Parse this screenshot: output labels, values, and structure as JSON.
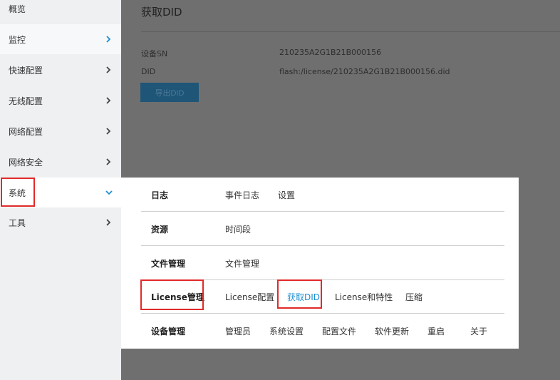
{
  "sidebar": {
    "items": [
      {
        "label": "概览",
        "chevron": false
      },
      {
        "label": "监控",
        "chevron": true
      },
      {
        "label": "快速配置",
        "chevron": true
      },
      {
        "label": "无线配置",
        "chevron": true
      },
      {
        "label": "网络配置",
        "chevron": true
      },
      {
        "label": "网络安全",
        "chevron": true
      },
      {
        "label": "系统",
        "chevron": true,
        "expanded": true
      },
      {
        "label": "工具",
        "chevron": true
      }
    ]
  },
  "content": {
    "title": "获取DID",
    "fields": [
      {
        "label": "设备SN",
        "value": "210235A2G1B21B000156"
      },
      {
        "label": "DID",
        "value": "flash:/license/210235A2G1B21B000156.did"
      }
    ],
    "export_button": "导出DID"
  },
  "flyout": {
    "groups": [
      {
        "label": "日志",
        "items": [
          "事件日志",
          "设置"
        ]
      },
      {
        "label": "资源",
        "items": [
          "时间段"
        ]
      },
      {
        "label": "文件管理",
        "items": [
          "文件管理"
        ]
      },
      {
        "label": "License管理",
        "items": [
          "License配置",
          "获取DID",
          "License和特性",
          "压缩"
        ]
      },
      {
        "label": "设备管理",
        "items": [
          "管理员",
          "系统设置",
          "配置文件",
          "软件更新",
          "重启",
          "关于"
        ]
      }
    ],
    "current_item": "获取DID"
  },
  "colors": {
    "accent": "#1e8fd0",
    "highlight": "#e12a2a"
  }
}
